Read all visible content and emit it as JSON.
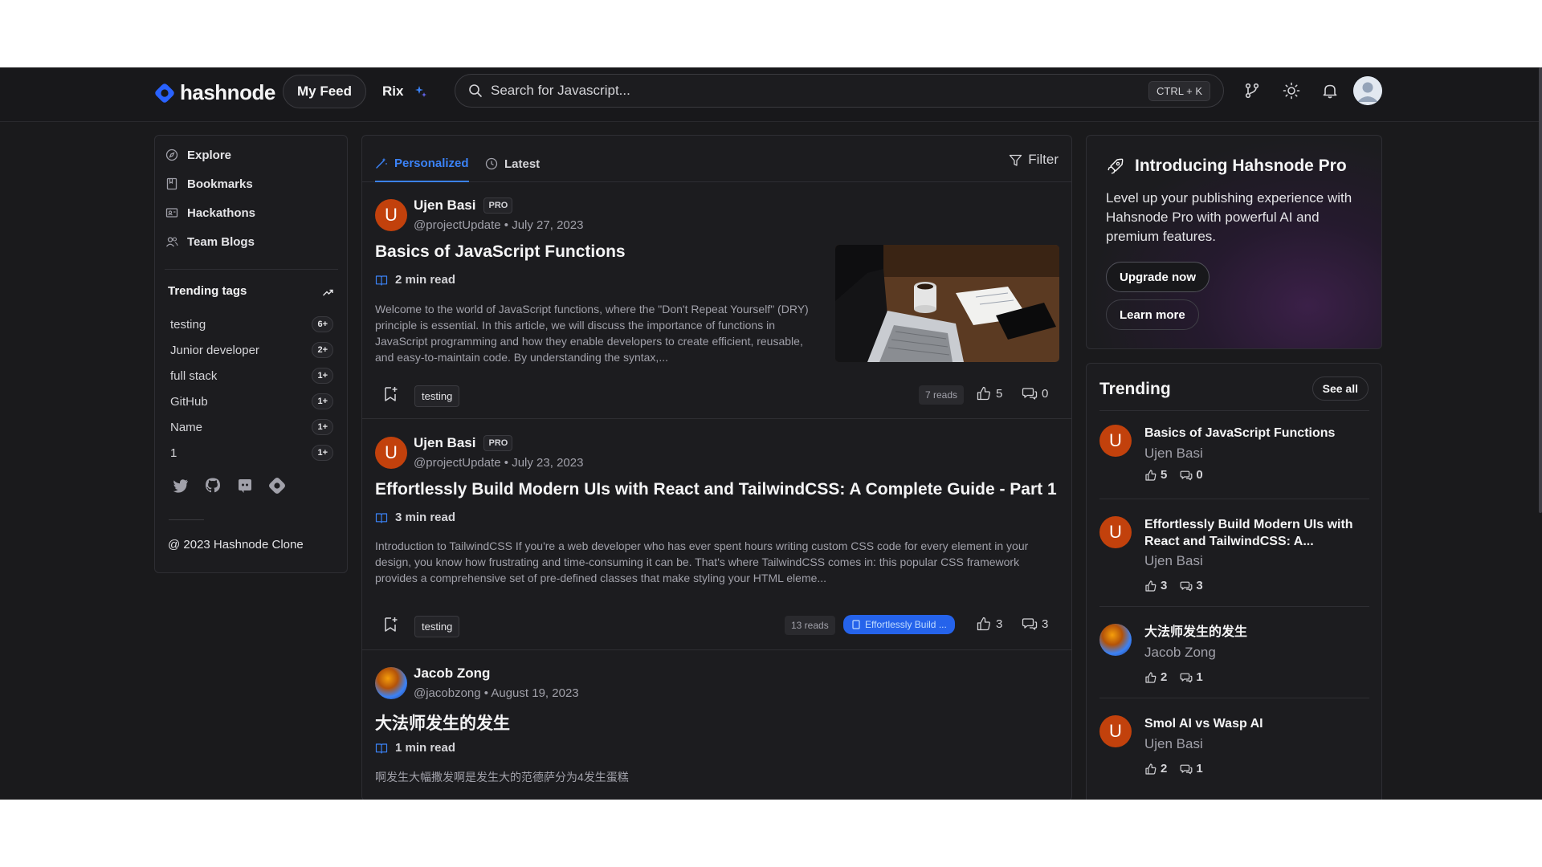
{
  "header": {
    "logo_text": "hashnode",
    "my_feed_label": "My Feed",
    "rix_label": "Rix",
    "search_placeholder": "Search for Javascript...",
    "search_shortcut": "CTRL + K"
  },
  "sidebar": {
    "nav": [
      {
        "label": "Explore",
        "icon": "compass-icon"
      },
      {
        "label": "Bookmarks",
        "icon": "bookmark-icon"
      },
      {
        "label": "Hackathons",
        "icon": "hackathon-icon"
      },
      {
        "label": "Team Blogs",
        "icon": "team-icon"
      }
    ],
    "trending_title": "Trending tags",
    "tags": [
      {
        "name": "testing",
        "count": "6+"
      },
      {
        "name": "Junior developer",
        "count": "2+"
      },
      {
        "name": "full stack",
        "count": "1+"
      },
      {
        "name": "GitHub",
        "count": "1+"
      },
      {
        "name": "Name",
        "count": "1+"
      },
      {
        "name": "1",
        "count": "1+"
      }
    ],
    "copyright": "@ 2023 Hashnode Clone"
  },
  "feed": {
    "tabs": [
      {
        "label": "Personalized",
        "active": true
      },
      {
        "label": "Latest",
        "active": false
      }
    ],
    "filter_label": "Filter",
    "posts": [
      {
        "author": "Ujen Basi",
        "badge": "PRO",
        "meta": "@projectUpdate • July 27, 2023",
        "title": "Basics of JavaScript Functions",
        "read_time": "2 min read",
        "excerpt": "Welcome to the world of JavaScript functions, where the \"Don't Repeat Yourself\" (DRY) principle is essential. In this article, we will discuss the importance of functions in JavaScript programming and how they enable developers to create efficient, reusable, and easy-to-maintain code. By understanding the syntax,...",
        "tag": "testing",
        "reads": "7 reads",
        "likes": "5",
        "comments": "0"
      },
      {
        "author": "Ujen Basi",
        "badge": "PRO",
        "meta": "@projectUpdate • July 23, 2023",
        "title": "Effortlessly Build Modern UIs with React and TailwindCSS: A Complete Guide - Part 1",
        "read_time": "3 min read",
        "excerpt": "Introduction to TailwindCSS If you're a web developer who has ever spent hours writing custom CSS code for every element in your design, you know how frustrating and time-consuming it can be. That's where TailwindCSS comes in: this popular CSS framework provides a comprehensive set of pre-defined classes that make styling your HTML eleme...",
        "tag": "testing",
        "reads": "13 reads",
        "series": "Effortlessly Build ...",
        "likes": "3",
        "comments": "3"
      },
      {
        "author": "Jacob Zong",
        "meta": "@jacobzong • August 19, 2023",
        "title": "大法师发生的发生",
        "read_time": "1 min read",
        "excerpt": "啊发生大幅撒发啊是发生大的范德萨分为4发生蛋糕"
      }
    ]
  },
  "pro_card": {
    "title": "Introducing Hahsnode Pro",
    "description": "Level up your publishing experience with Hahsnode Pro with powerful AI and premium features.",
    "upgrade_label": "Upgrade now",
    "learn_label": "Learn more"
  },
  "trending": {
    "title": "Trending",
    "see_all_label": "See all",
    "items": [
      {
        "title": "Basics of JavaScript Functions",
        "author": "Ujen Basi",
        "likes": "5",
        "comments": "0"
      },
      {
        "title": "Effortlessly Build Modern UIs with React and TailwindCSS: A...",
        "author": "Ujen Basi",
        "likes": "3",
        "comments": "3"
      },
      {
        "title": "大法师发生的发生",
        "author": "Jacob Zong",
        "likes": "2",
        "comments": "1"
      },
      {
        "title": "Smol AI vs Wasp AI",
        "author": "Ujen Basi",
        "likes": "2",
        "comments": "1"
      }
    ]
  },
  "colors": {
    "accent": "#3b82f6",
    "avatar_orange": "#c2410c",
    "background": "#1a1a1c"
  }
}
